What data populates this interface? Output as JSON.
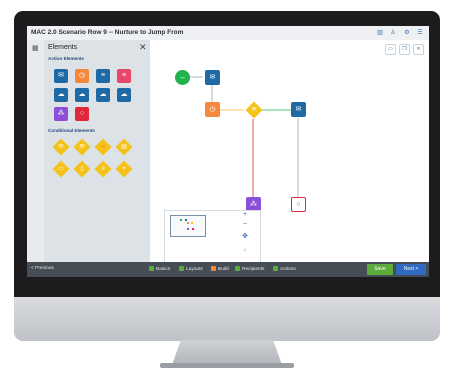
{
  "app": {
    "title": "MAC 2.0 Scenario Row 9 -- Nurture to Jump From"
  },
  "titlebar": {
    "icons": [
      "analytics-icon",
      "user-icon",
      "settings-icon",
      "menu-icon"
    ]
  },
  "panel": {
    "title": "Elements",
    "close_label": "✕",
    "action_section": "Action Elements",
    "conditional_section": "Conditional Elements"
  },
  "canvas_toolbar": {
    "icons": [
      "calendar-icon",
      "copy-icon",
      "trash-icon"
    ]
  },
  "zoom": {
    "in": "+",
    "out": "−",
    "center": "✥",
    "arrow": "‹"
  },
  "footer": {
    "previous": "< Previous",
    "steps": [
      {
        "label": "Basics"
      },
      {
        "label": "Layouts"
      },
      {
        "label": "Build"
      },
      {
        "label": "Recipients"
      },
      {
        "label": "Actions"
      }
    ],
    "save": "Save",
    "next": "Next >"
  },
  "colors": {
    "accent_blue": "#1f6aa5",
    "orange": "#f5883c",
    "pink": "#e8476b",
    "purple": "#8a4fd6",
    "red": "#e0283a",
    "yellow": "#f4c21b",
    "green": "#23b24c",
    "footer_bg": "#474d55"
  }
}
